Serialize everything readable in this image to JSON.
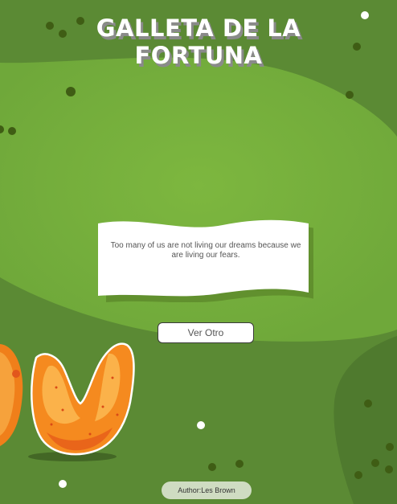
{
  "title": {
    "line1": "GALLETA DE LA",
    "line2": "FORTUNA"
  },
  "fortune": {
    "quote": "Too many of us are not living our dreams because we are living our fears."
  },
  "button": {
    "label": "Ver Otro"
  },
  "author": {
    "label": "Author:Les Brown"
  },
  "colors": {
    "background_dark": "#5b8a34",
    "background_light": "#7eb941",
    "dot_dark": "#3f5d14",
    "dot_light": "#ffffff",
    "cookie_orange": "#f58a1f"
  },
  "icons": [
    "fortune-cookie-icon",
    "fortune-paper-icon"
  ]
}
